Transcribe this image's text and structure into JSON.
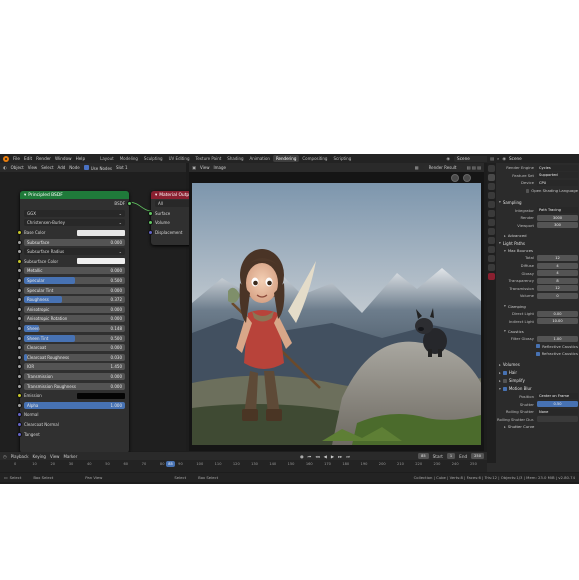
{
  "menubar": {
    "items": [
      "File",
      "Edit",
      "Render",
      "Window",
      "Help"
    ],
    "workspaces": [
      "Layout",
      "Modeling",
      "Sculpting",
      "UV Editing",
      "Texture Paint",
      "Shading",
      "Animation",
      "Rendering",
      "Compositing",
      "Scripting"
    ],
    "active_workspace": "Rendering",
    "scene": "Scene",
    "view_layer": "View Layer"
  },
  "node_editor": {
    "header": {
      "object": "Object",
      "view": "View",
      "select": "Select",
      "add": "Add",
      "node": "Node",
      "use_nodes": "Use Nodes",
      "slot": "Slot 1"
    },
    "principled": {
      "title": "Principled BSDF",
      "output": "BSDF",
      "distribution": "GGX",
      "sss_method": "Christensen-Burley",
      "rows": [
        {
          "label": "Base Color",
          "type": "color",
          "color": "#e8e8e8"
        },
        {
          "label": "Subsurface",
          "type": "value",
          "value": "0.000",
          "fill": 0
        },
        {
          "label": "Subsurface Radius",
          "type": "dropdown"
        },
        {
          "label": "Subsurface Color",
          "type": "color",
          "color": "#efefef"
        },
        {
          "label": "Metallic",
          "type": "value",
          "value": "0.000",
          "fill": 0
        },
        {
          "label": "Specular",
          "type": "value",
          "value": "0.500",
          "fill": 0.5
        },
        {
          "label": "Specular Tint",
          "type": "value",
          "value": "0.000",
          "fill": 0
        },
        {
          "label": "Roughness",
          "type": "value",
          "value": "0.372",
          "fill": 0.372
        },
        {
          "label": "Anisotropic",
          "type": "value",
          "value": "0.000",
          "fill": 0
        },
        {
          "label": "Anisotropic Rotation",
          "type": "value",
          "value": "0.000",
          "fill": 0
        },
        {
          "label": "Sheen",
          "type": "value",
          "value": "0.148",
          "fill": 0.148
        },
        {
          "label": "Sheen Tint",
          "type": "value",
          "value": "0.500",
          "fill": 0.5
        },
        {
          "label": "Clearcoat",
          "type": "value",
          "value": "0.000",
          "fill": 0
        },
        {
          "label": "Clearcoat Roughness",
          "type": "value",
          "value": "0.030",
          "fill": 0.03
        },
        {
          "label": "IOR",
          "type": "value",
          "value": "1.450",
          "fill": 0
        },
        {
          "label": "Transmission",
          "type": "value",
          "value": "0.000",
          "fill": 0
        },
        {
          "label": "Transmission Roughness",
          "type": "value",
          "value": "0.000",
          "fill": 0
        },
        {
          "label": "Emission",
          "type": "color",
          "color": "#050505"
        },
        {
          "label": "Alpha",
          "type": "value",
          "value": "1.000",
          "fill": 1
        },
        {
          "label": "Normal",
          "type": "plain"
        },
        {
          "label": "Clearcoat Normal",
          "type": "plain"
        },
        {
          "label": "Tangent",
          "type": "plain"
        }
      ]
    },
    "output_node": {
      "title": "Material Output",
      "target": "All",
      "inputs": [
        "Surface",
        "Volume",
        "Displacement"
      ]
    }
  },
  "image_editor": {
    "header": {
      "view": "View",
      "image": "Image",
      "render_result": "Render Result"
    }
  },
  "properties": {
    "header_title": "Scene",
    "render_engine_label": "Render Engine",
    "render_engine": "Cycles",
    "feature_set_label": "Feature Set",
    "feature_set": "Supported",
    "device_label": "Device",
    "device": "CPU",
    "osl_label": "Open Shading Language",
    "sampling_title": "Sampling",
    "integrator_label": "Integrator",
    "integrator": "Path Tracing",
    "render_label": "Render",
    "render_samples": "3000",
    "viewport_label": "Viewport",
    "viewport_samples": "300",
    "advanced_title": "Advanced",
    "light_paths_title": "Light Paths",
    "max_bounces_title": "Max Bounces",
    "bounces": [
      {
        "label": "Total",
        "value": "12"
      },
      {
        "label": "Diffuse",
        "value": "4"
      },
      {
        "label": "Glossy",
        "value": "4"
      },
      {
        "label": "Transparency",
        "value": "8"
      },
      {
        "label": "Transmission",
        "value": "12"
      },
      {
        "label": "Volume",
        "value": "0"
      }
    ],
    "clamping_title": "Clamping",
    "clamp_direct_label": "Direct Light",
    "clamp_direct": "0.00",
    "clamp_indirect_label": "Indirect Light",
    "clamp_indirect": "10.00",
    "caustics_title": "Caustics",
    "filter_glossy_label": "Filter Glossy",
    "filter_glossy": "1.00",
    "reflective_label": "Reflective Caustics",
    "refractive_label": "Refractive Caustics",
    "volumes_title": "Volumes",
    "hair_title": "Hair",
    "simplify_title": "Simplify",
    "motion_blur_title": "Motion Blur",
    "position_label": "Position",
    "position": "Center on Frame",
    "shutter_label": "Shutter",
    "shutter": "0.50",
    "rolling_shutter_label": "Rolling Shutter",
    "rolling_shutter": "None",
    "rolling_duration_label": "Rolling Shutter Dur.",
    "shutter_curve_title": "Shutter Curve"
  },
  "timeline": {
    "playback": "Playback",
    "keying": "Keying",
    "view": "View",
    "marker": "Marker",
    "current_frame": "85",
    "start_label": "Start",
    "start": "1",
    "end_label": "End",
    "end": "250",
    "ticks": [
      "0",
      "10",
      "20",
      "30",
      "40",
      "50",
      "60",
      "70",
      "80",
      "90",
      "100",
      "110",
      "120",
      "130",
      "140",
      "150",
      "160",
      "170",
      "180",
      "190",
      "200",
      "210",
      "220",
      "230",
      "240",
      "250"
    ]
  },
  "statusbar": {
    "select": "Select",
    "box_select": "Box Select",
    "pan_view": "Pan View",
    "select2": "Select",
    "box_select2": "Box Select",
    "stats": "Collection | Cube | Verts:8 | Faces:6 | Tris:12 | Objects:1/3 | Mem: 23.0 MiB | v2.80.74"
  },
  "colors": {
    "accent": "#4772b3",
    "principled_header": "#1f7a3a",
    "output_header": "#8a2030",
    "shader_socket": "#63c763",
    "color_socket": "#c7c729",
    "value_socket": "#a1a1a1",
    "vector_socket": "#6363c7"
  }
}
